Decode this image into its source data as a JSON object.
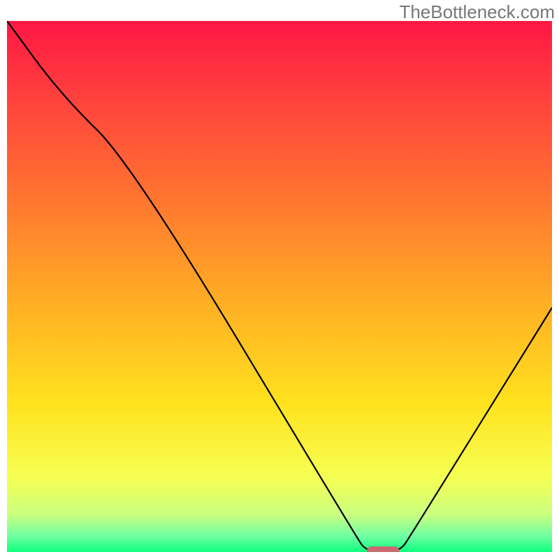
{
  "watermark": "TheBottleneck.com",
  "chart_data": {
    "type": "line",
    "title": "",
    "xlabel": "",
    "ylabel": "",
    "xlim": [
      0,
      100
    ],
    "ylim": [
      0,
      100
    ],
    "series": [
      {
        "name": "bottleneck-curve",
        "x": [
          0,
          10,
          23,
          64,
          66,
          72,
          74,
          100
        ],
        "y": [
          100,
          86,
          73,
          3,
          0,
          0,
          3,
          46
        ]
      }
    ],
    "marker": {
      "name": "optimal-marker",
      "x_start": 66,
      "x_end": 72,
      "y": 0,
      "color": "#c96b70"
    },
    "gradient_stops": [
      {
        "offset": 0.0,
        "color": "#ff1744"
      },
      {
        "offset": 0.12,
        "color": "#ff3a3f"
      },
      {
        "offset": 0.35,
        "color": "#ff7a2e"
      },
      {
        "offset": 0.55,
        "color": "#ffb424"
      },
      {
        "offset": 0.72,
        "color": "#ffe21e"
      },
      {
        "offset": 0.86,
        "color": "#f6ff53"
      },
      {
        "offset": 0.93,
        "color": "#c9ff80"
      },
      {
        "offset": 0.97,
        "color": "#6fffa2"
      },
      {
        "offset": 1.0,
        "color": "#0dff7d"
      }
    ]
  }
}
